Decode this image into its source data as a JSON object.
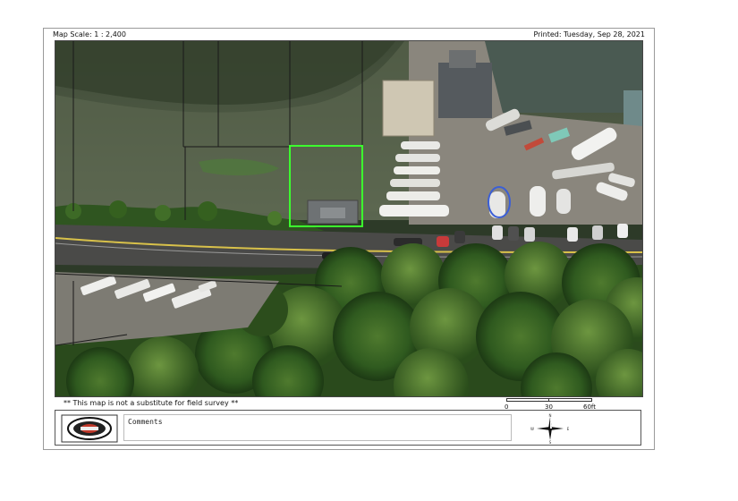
{
  "header": {
    "map_scale": "Map Scale: 1 : 2,400",
    "printed": "Printed: Tuesday, Sep 28, 2021"
  },
  "disclaimer": "** This map is not a substitute for field survey **",
  "scale_bar": {
    "ticks": [
      "0",
      "30",
      "60ft"
    ]
  },
  "footer": {
    "comments_label": "Comments",
    "logo_icon": "county-seal-icon",
    "compass_icon": "north-arrow-compass-icon",
    "compass": {
      "n": "N",
      "s": "S",
      "e": "E",
      "w": "W"
    }
  },
  "colors": {
    "parcel_highlight": "#3cff2e",
    "parcel_lines": "#1a1a1a",
    "water": "#55604a",
    "road": "#4a4a48"
  }
}
